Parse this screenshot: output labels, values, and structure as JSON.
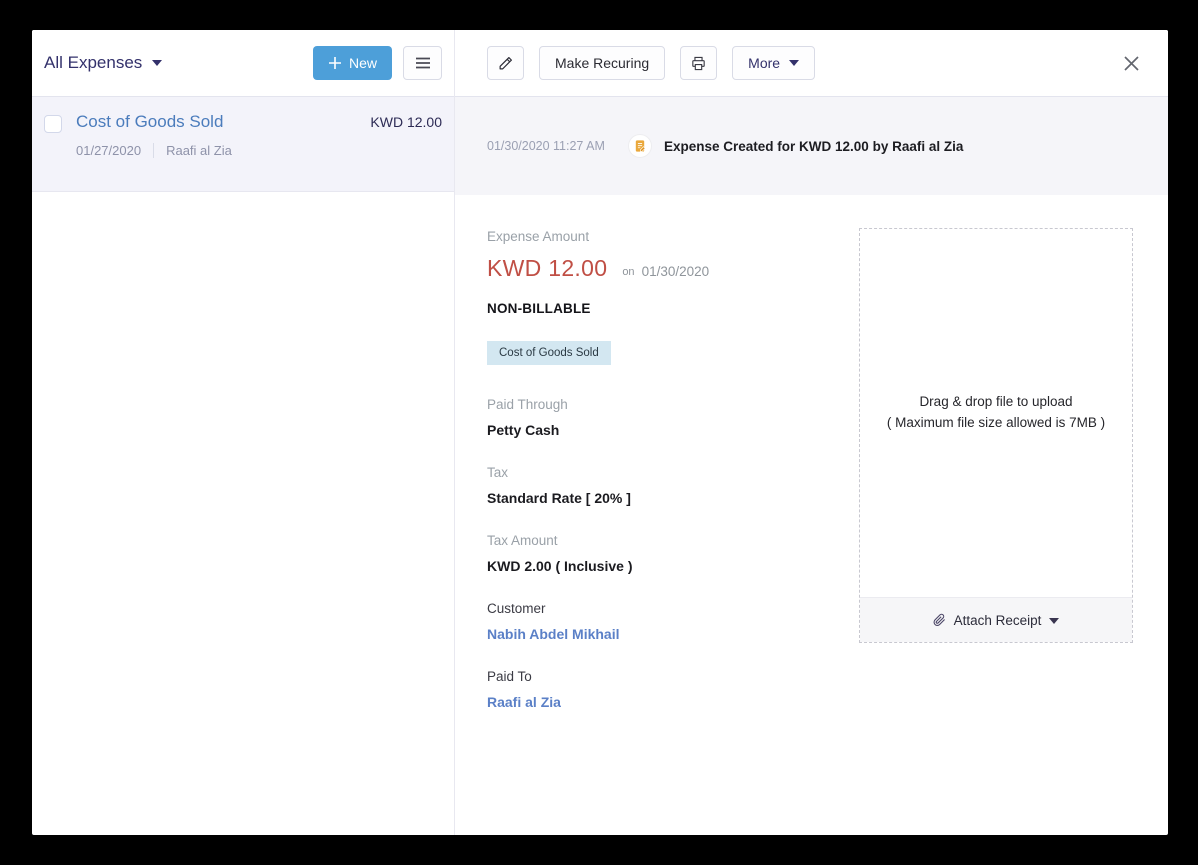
{
  "list_header": {
    "title": "All Expenses",
    "new_label": "New"
  },
  "detail_toolbar": {
    "make_recurring_label": "Make Recuring",
    "more_label": "More"
  },
  "expense_list": {
    "items": [
      {
        "title": "Cost of Goods Sold",
        "amount": "KWD 12.00",
        "date": "01/27/2020",
        "contact": "Raafi al Zia",
        "selected": true
      }
    ]
  },
  "history": {
    "timestamp": "01/30/2020 11:27 AM",
    "event": "Expense Created for KWD 12.00 by Raafi al Zia"
  },
  "detail": {
    "expense_amount_label": "Expense Amount",
    "amount": "KWD 12.00",
    "on_label": "on",
    "date": "01/30/2020",
    "billable_status": "NON-BILLABLE",
    "category_tag": "Cost of Goods Sold",
    "paid_through_label": "Paid Through",
    "paid_through_value": "Petty Cash",
    "tax_label": "Tax",
    "tax_value": "Standard Rate [ 20% ]",
    "tax_amount_label": "Tax Amount",
    "tax_amount_value": "KWD 2.00 ( Inclusive )",
    "customer_label": "Customer",
    "customer_value": "Nabih Abdel Mikhail",
    "paid_to_label": "Paid To",
    "paid_to_value": "Raafi al Zia"
  },
  "upload": {
    "drag_line1": "Drag & drop file to upload",
    "drag_line2": "( Maximum file size allowed is 7MB )",
    "attach_label": "Attach Receipt"
  },
  "colors": {
    "accent_blue": "#4d9fd9",
    "link_blue": "#5b80c7",
    "amount_red": "#c04f45",
    "tag_bg": "#d3e7f1",
    "history_icon_amber": "#eaa83b"
  }
}
